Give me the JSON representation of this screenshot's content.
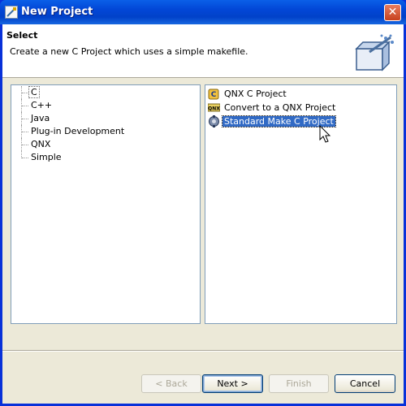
{
  "window": {
    "title": "New Project",
    "close_glyph": "✕"
  },
  "banner": {
    "title": "Select",
    "description": "Create a new C Project which uses a simple makefile."
  },
  "wizards_tree": {
    "items": [
      {
        "label": "C",
        "focused": true
      },
      {
        "label": "C++"
      },
      {
        "label": "Java"
      },
      {
        "label": "Plug-in Development"
      },
      {
        "label": "QNX"
      },
      {
        "label": "Simple"
      }
    ]
  },
  "project_list": {
    "items": [
      {
        "label": "QNX C Project",
        "icon": "qnx-c-project-icon",
        "selected": false
      },
      {
        "label": "Convert to a QNX Project",
        "icon": "qnx-convert-icon",
        "selected": false
      },
      {
        "label": "Standard Make C Project",
        "icon": "make-c-project-icon",
        "selected": true
      }
    ]
  },
  "buttons": {
    "back": "< Back",
    "next": "Next >",
    "finish": "Finish",
    "cancel": "Cancel"
  },
  "colors": {
    "selection": "#316ac5",
    "titlebar": "#0246d6",
    "dialog_bg": "#ece9d8"
  }
}
